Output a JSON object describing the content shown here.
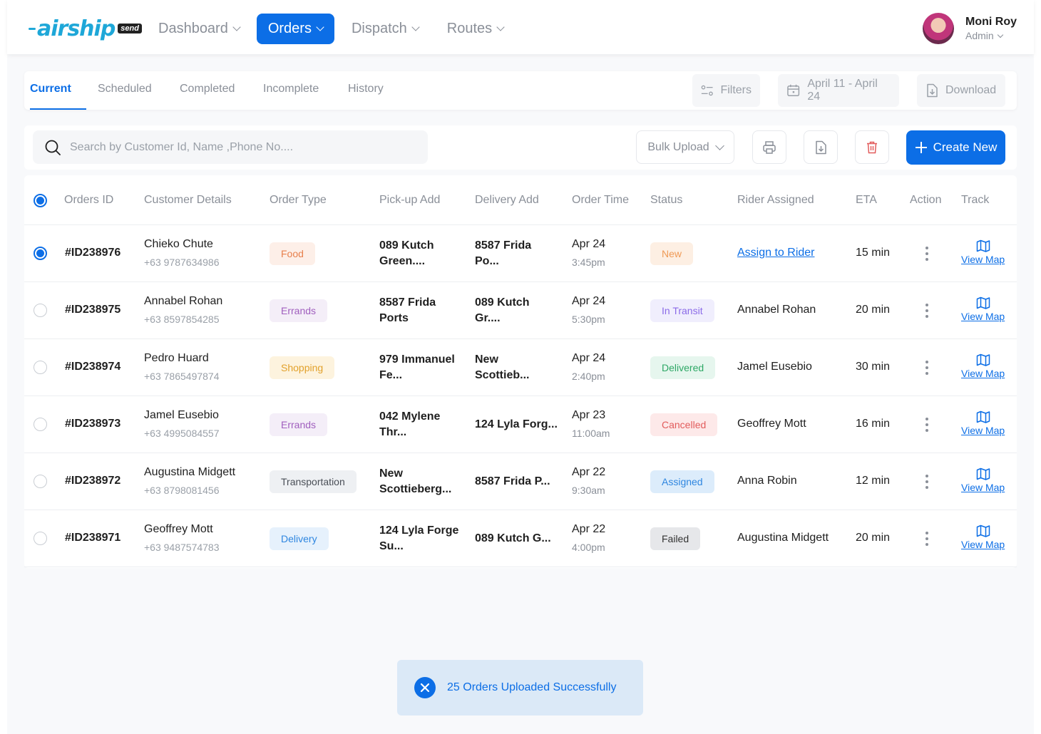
{
  "brand": {
    "logo_text": "airship",
    "badge": "send"
  },
  "nav": [
    {
      "label": "Dashboard",
      "active": false
    },
    {
      "label": "Orders",
      "active": true
    },
    {
      "label": "Dispatch",
      "active": false
    },
    {
      "label": "Routes",
      "active": false
    }
  ],
  "user": {
    "name": "Moni Roy",
    "role": "Admin"
  },
  "tabs": [
    "Current",
    "Scheduled",
    "Completed",
    "Incomplete",
    "History"
  ],
  "tools": {
    "filters": "Filters",
    "date_range": "April 11 - April 24",
    "download": "Download"
  },
  "toolbar": {
    "search_placeholder": "Search by Customer Id, Name ,Phone No....",
    "bulk_upload": "Bulk Upload",
    "create_new": "Create New"
  },
  "columns": [
    "Orders ID",
    "Customer Details",
    "Order Type",
    "Pick-up Add",
    "Delivery Add",
    "Order Time",
    "Status",
    "Rider Assigned",
    "ETA",
    "Action",
    "Track"
  ],
  "rows": [
    {
      "selected": true,
      "id": "#ID238976",
      "name": "Chieko Chute",
      "phone": "+63 9787634986",
      "type": "Food",
      "pickup": [
        "089 Kutch",
        "Green...."
      ],
      "delivery": [
        "8587 Frida",
        "Po..."
      ],
      "date": "Apr 24",
      "time": "3:45pm",
      "status": "New",
      "rider": "Assign to Rider",
      "rider_link": true,
      "eta": "15 min",
      "track": "View Map"
    },
    {
      "selected": false,
      "id": "#ID238975",
      "name": "Annabel Rohan",
      "phone": "+63 8597854285",
      "type": "Errands",
      "pickup": [
        "8587 Frida",
        "Ports"
      ],
      "delivery": [
        "089 Kutch",
        "Gr...."
      ],
      "date": "Apr 24",
      "time": "5:30pm",
      "status": "In Transit",
      "rider": "Annabel Rohan",
      "rider_link": false,
      "eta": "20 min",
      "track": "View Map"
    },
    {
      "selected": false,
      "id": "#ID238974",
      "name": "Pedro Huard",
      "phone": "+63 7865497874",
      "type": "Shopping",
      "pickup": [
        "979 Immanuel",
        "Fe..."
      ],
      "delivery": [
        "New",
        "Scottieb..."
      ],
      "date": "Apr 24",
      "time": "2:40pm",
      "status": "Delivered",
      "rider": "Jamel Eusebio",
      "rider_link": false,
      "eta": "30 min",
      "track": "View Map"
    },
    {
      "selected": false,
      "id": "#ID238973",
      "name": "Jamel Eusebio",
      "phone": "+63 4995084557",
      "type": "Errands",
      "pickup": [
        "042 Mylene",
        "Thr..."
      ],
      "delivery": [
        "124 Lyla Forg..."
      ],
      "date": "Apr 23",
      "time": "11:00am",
      "status": "Cancelled",
      "rider": "Geoffrey Mott",
      "rider_link": false,
      "eta": "16 min",
      "track": "View Map"
    },
    {
      "selected": false,
      "id": "#ID238972",
      "name": "Augustina Midgett",
      "phone": "+63 8798081456",
      "type": "Transportation",
      "pickup": [
        "New",
        "Scottieberg..."
      ],
      "delivery": [
        "8587 Frida P..."
      ],
      "date": "Apr 22",
      "time": "9:30am",
      "status": "Assigned",
      "rider": "Anna Robin",
      "rider_link": false,
      "eta": "12 min",
      "track": "View Map"
    },
    {
      "selected": false,
      "id": "#ID238971",
      "name": "Geoffrey Mott",
      "phone": "+63 9487574783",
      "type": "Delivery",
      "pickup": [
        "124 Lyla Forge",
        "Su..."
      ],
      "delivery": [
        "089 Kutch G..."
      ],
      "date": "Apr 22",
      "time": "4:00pm",
      "status": "Failed",
      "rider": "Augustina Midgett",
      "rider_link": false,
      "eta": "20 min",
      "track": "View Map"
    }
  ],
  "type_colors": {
    "Food": {
      "bg": "#fdefe8",
      "fg": "#e8804d"
    },
    "Errands": {
      "bg": "#f4eef8",
      "fg": "#a05fbe"
    },
    "Shopping": {
      "bg": "#fdf3de",
      "fg": "#e2a12b"
    },
    "Transportation": {
      "bg": "#eef0f3",
      "fg": "#4a4f57"
    },
    "Delivery": {
      "bg": "#e6f1fc",
      "fg": "#2e86e0"
    }
  },
  "status_colors": {
    "New": {
      "bg": "#fdefe3",
      "fg": "#ef9a56"
    },
    "In Transit": {
      "bg": "#f0eefd",
      "fg": "#8b6be8"
    },
    "Delivered": {
      "bg": "#e6f6ee",
      "fg": "#2ea866"
    },
    "Cancelled": {
      "bg": "#fde9e9",
      "fg": "#e25c5c"
    },
    "Assigned": {
      "bg": "#dcecfb",
      "fg": "#2e86e0"
    },
    "Failed": {
      "bg": "#e6e7ea",
      "fg": "#333333"
    }
  },
  "toast": {
    "message": "25 Orders Uploaded Successfully"
  },
  "accent": "#0c6ee6"
}
